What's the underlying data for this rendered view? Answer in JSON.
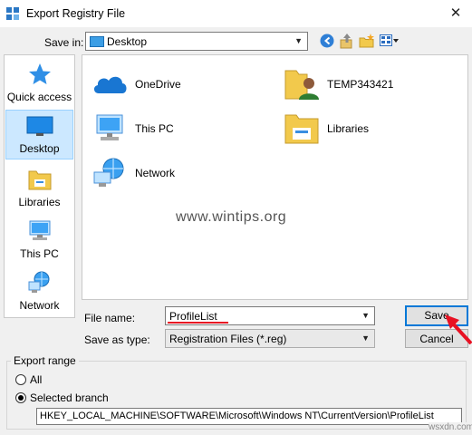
{
  "window": {
    "title": "Export Registry File",
    "close_glyph": "✕"
  },
  "save_in": {
    "label": "Save in:",
    "value": "Desktop"
  },
  "toolbar": {
    "back_icon": "back-arrow-icon",
    "up_icon": "up-folder-icon",
    "new_folder_icon": "new-folder-icon",
    "view_icon": "view-menu-icon"
  },
  "sidebar": {
    "items": [
      {
        "label": "Quick access",
        "icon": "star-icon",
        "selected": false
      },
      {
        "label": "Desktop",
        "icon": "desktop-icon",
        "selected": true
      },
      {
        "label": "Libraries",
        "icon": "libraries-icon",
        "selected": false
      },
      {
        "label": "This PC",
        "icon": "computer-icon",
        "selected": false
      },
      {
        "label": "Network",
        "icon": "network-icon",
        "selected": false
      }
    ]
  },
  "files": {
    "items": [
      {
        "label": "OneDrive",
        "icon": "onedrive-icon"
      },
      {
        "label": "TEMP343421",
        "icon": "user-folder-icon"
      },
      {
        "label": "This PC",
        "icon": "computer-icon"
      },
      {
        "label": "Libraries",
        "icon": "libraries-icon"
      },
      {
        "label": "Network",
        "icon": "network-icon"
      }
    ],
    "watermark": "www.wintips.org"
  },
  "form": {
    "file_name_label": "File name:",
    "file_name_value": "ProfileList",
    "save_type_label": "Save as type:",
    "save_type_value": "Registration Files (*.reg)"
  },
  "buttons": {
    "save": "Save",
    "cancel": "Cancel"
  },
  "export_range": {
    "title": "Export range",
    "all_label": "All",
    "selected_label": "Selected branch",
    "selected_checked": true,
    "branch_path": "HKEY_LOCAL_MACHINE\\SOFTWARE\\Microsoft\\Windows NT\\CurrentVersion\\ProfileList"
  },
  "site_watermark": "wsxdn.com",
  "colors": {
    "accent": "#0078d7",
    "annotation": "#e81123",
    "selection": "#cce8ff"
  }
}
